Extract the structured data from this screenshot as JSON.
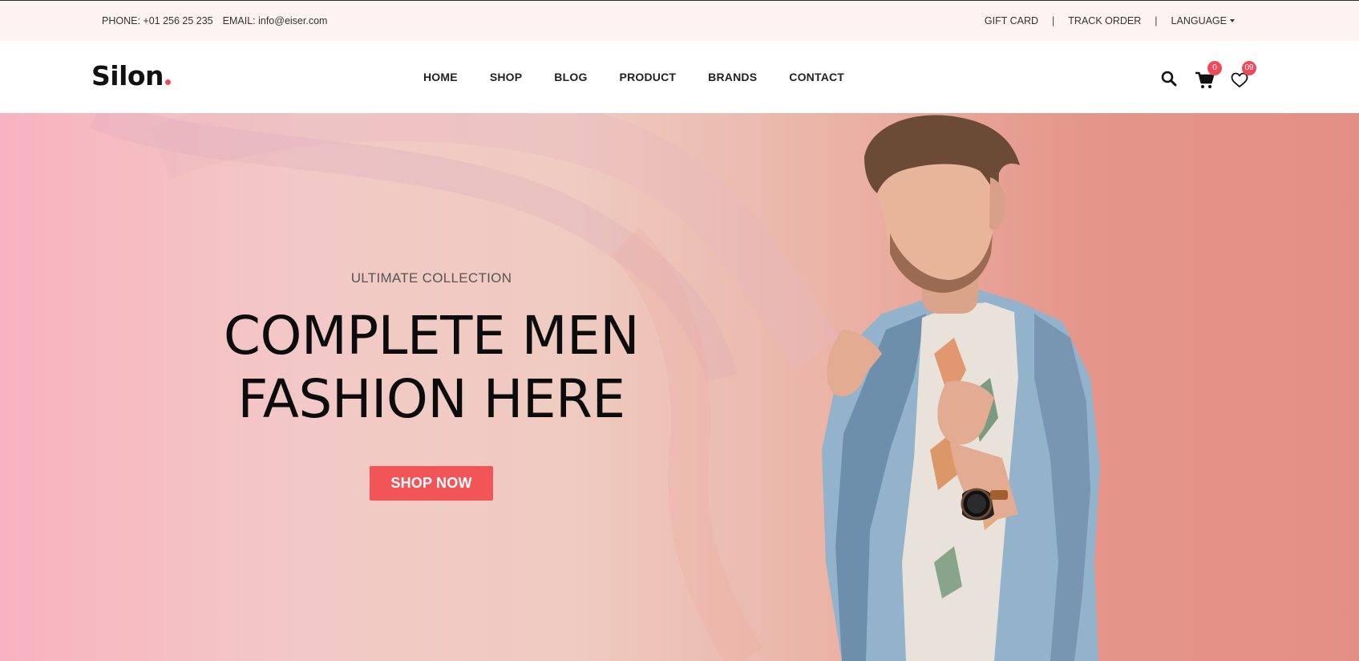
{
  "topbar": {
    "phone": "PHONE: +01 256 25 235",
    "email": "EMAIL: info@eiser.com",
    "gift_card": "GIFT CARD",
    "separator": "|",
    "track_order": "TRACK ORDER",
    "language": "LANGUAGE"
  },
  "header": {
    "logo": "Silon",
    "nav": [
      "HOME",
      "SHOP",
      "BLOG",
      "PRODUCT",
      "BRANDS",
      "CONTACT"
    ],
    "cart_count": "0",
    "wishlist_count": "09",
    "icons": [
      "search-icon",
      "cart-icon",
      "heart-icon"
    ]
  },
  "hero": {
    "subtitle": "ULTIMATE COLLECTION",
    "title_line1": "COMPLETE MEN",
    "title_line2": "FASHION HERE",
    "button": "SHOP NOW"
  },
  "colors": {
    "accent": "#f25457",
    "topbar_bg": "#fdf3f1",
    "hero_left": "#f8b2bf",
    "hero_right": "#e38f86"
  }
}
